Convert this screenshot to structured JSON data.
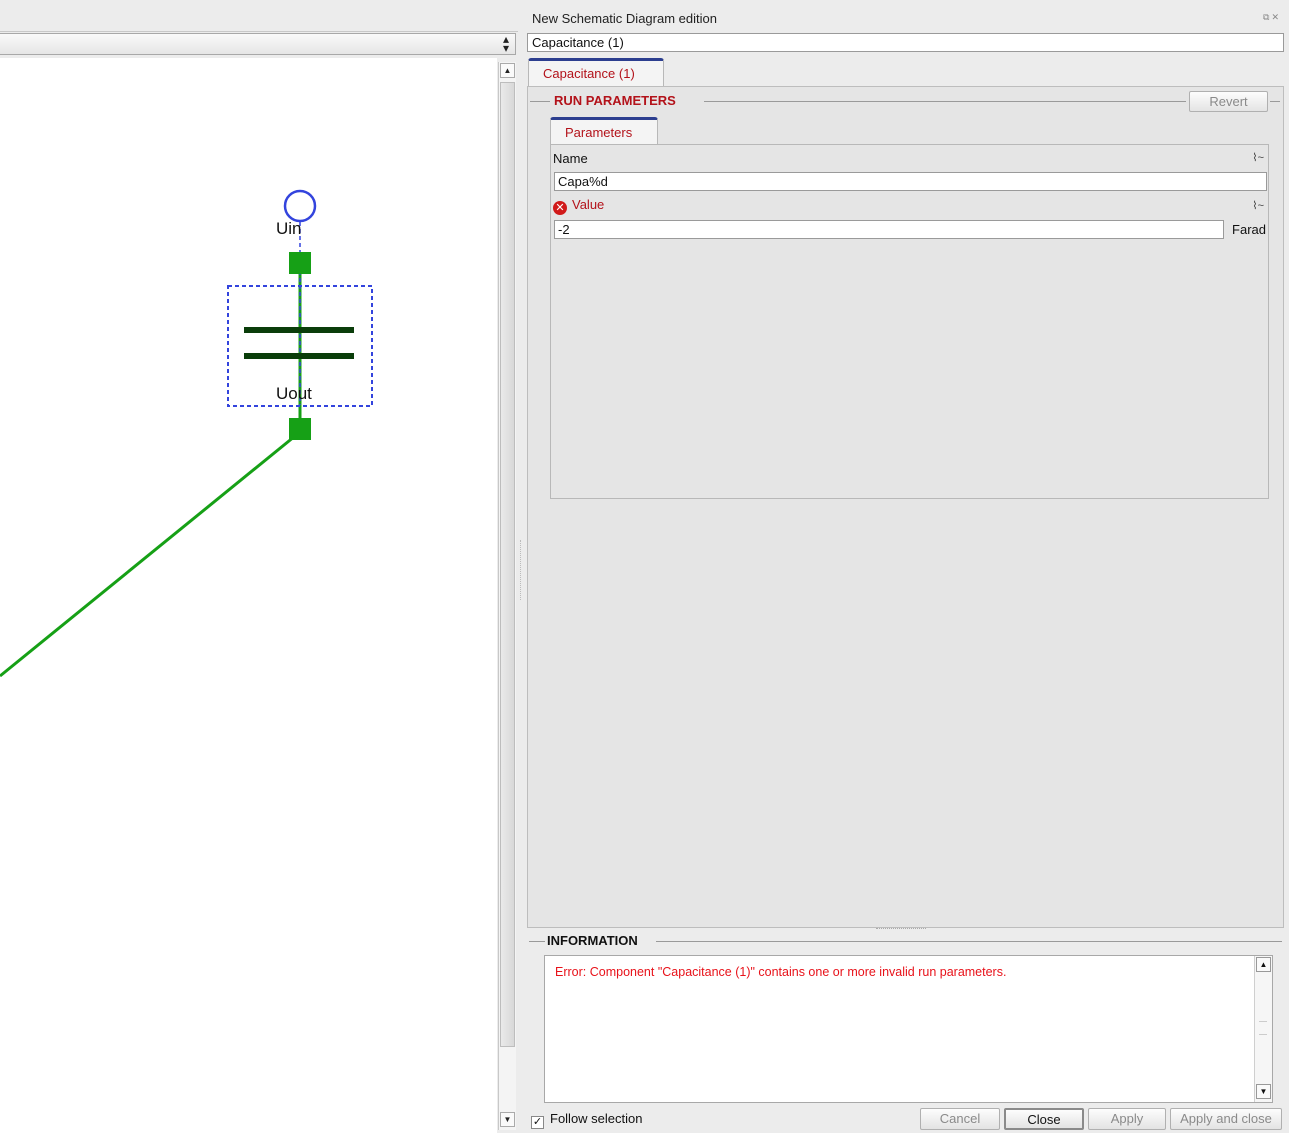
{
  "canvas": {
    "labels": {
      "uin": "Uin",
      "uout": "Uout"
    }
  },
  "dock": {
    "title": "New Schematic Diagram edition",
    "component_name": "Capacitance (1)",
    "tab_label": "Capacitance (1)",
    "run_parameters": {
      "title": "RUN PARAMETERS",
      "revert_label": "Revert",
      "sub_tab": "Parameters",
      "fields": {
        "name": {
          "label": "Name",
          "value": "Capa%d"
        },
        "value": {
          "label": "Value",
          "value": "-2",
          "unit": "Farad",
          "status": "error"
        }
      }
    },
    "information": {
      "title": "INFORMATION",
      "message": "Error: Component \"Capacitance (1)\" contains one or more invalid run parameters."
    },
    "footer": {
      "follow_selection": "Follow selection",
      "follow_checked": true,
      "buttons": {
        "cancel": "Cancel",
        "close": "Close",
        "apply": "Apply",
        "apply_close": "Apply and close"
      }
    }
  },
  "colors": {
    "error": "#e8121a",
    "tab_text": "#b3121a",
    "wire": "#16a016",
    "selection": "#3344dd"
  }
}
